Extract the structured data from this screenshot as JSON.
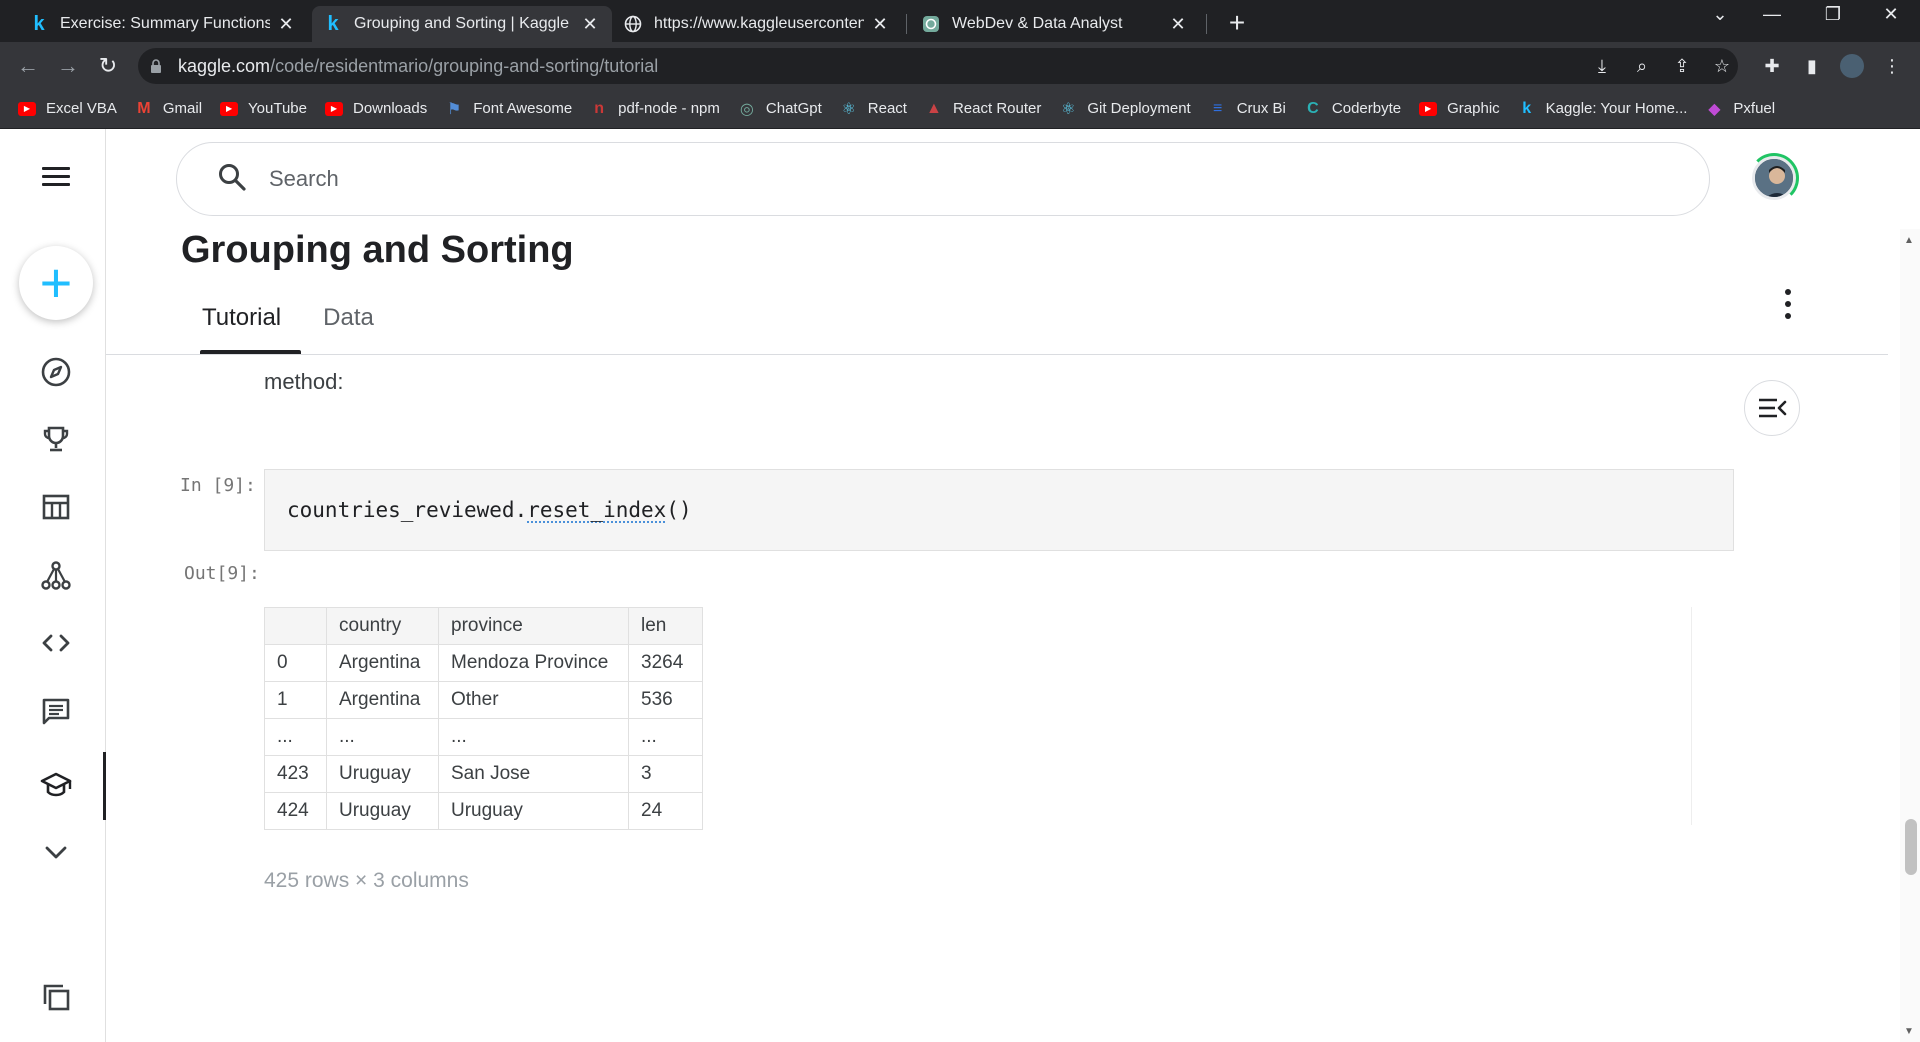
{
  "browser": {
    "tabs": [
      {
        "title": "Exercise: Summary Functions and",
        "favicon": "kaggle-k",
        "active": false
      },
      {
        "title": "Grouping and Sorting | Kaggle",
        "favicon": "kaggle-k",
        "active": true
      },
      {
        "title": "https://www.kaggleusercontent.c",
        "favicon": "globe",
        "active": false
      },
      {
        "title": "WebDev & Data Analyst",
        "favicon": "chatgpt",
        "active": false
      }
    ],
    "url_host": "kaggle.com",
    "url_path": "/code/residentmario/grouping-and-sorting/tutorial",
    "bookmarks": [
      {
        "label": "Excel VBA",
        "icon": "youtube",
        "color": "#ff0000"
      },
      {
        "label": "Gmail",
        "icon": "gmail",
        "color": "#ea4335"
      },
      {
        "label": "YouTube",
        "icon": "youtube",
        "color": "#ff0000"
      },
      {
        "label": "Downloads",
        "icon": "youtube",
        "color": "#ff0000"
      },
      {
        "label": "Font Awesome",
        "icon": "flag",
        "color": "#538dd7"
      },
      {
        "label": "pdf-node - npm",
        "icon": "npm",
        "color": "#cb3837"
      },
      {
        "label": "ChatGpt",
        "icon": "chatgpt",
        "color": "#74aa9c"
      },
      {
        "label": "React",
        "icon": "react",
        "color": "#61dafb"
      },
      {
        "label": "React Router",
        "icon": "react-router",
        "color": "#ca4245"
      },
      {
        "label": "Git Deployment",
        "icon": "react",
        "color": "#61dafb"
      },
      {
        "label": "Crux Bi",
        "icon": "crux",
        "color": "#2f6fde"
      },
      {
        "label": "Coderbyte",
        "icon": "coderbyte",
        "color": "#2bb1b5"
      },
      {
        "label": "Graphic",
        "icon": "youtube",
        "color": "#ff0000"
      },
      {
        "label": "Kaggle: Your Home...",
        "icon": "kaggle-k",
        "color": "#20beff"
      },
      {
        "label": "Pxfuel",
        "icon": "pxfuel",
        "color": "#c04bd6"
      }
    ]
  },
  "search": {
    "placeholder": "Search"
  },
  "notebook": {
    "title": "Grouping and Sorting",
    "tabs": [
      "Tutorial",
      "Data"
    ],
    "active_tab": "Tutorial",
    "prose_tail": "method:",
    "cell_in_prompt": "In [9]:",
    "cell_code_obj": "countries_reviewed.",
    "cell_code_fn": "reset_index",
    "cell_code_args": "()",
    "cell_out_prompt": "Out[9]:",
    "table": {
      "columns": [
        "",
        "country",
        "province",
        "len"
      ],
      "rows": [
        [
          "0",
          "Argentina",
          "Mendoza Province",
          "3264"
        ],
        [
          "1",
          "Argentina",
          "Other",
          "536"
        ],
        [
          "...",
          "...",
          "...",
          "..."
        ],
        [
          "423",
          "Uruguay",
          "San Jose",
          "3"
        ],
        [
          "424",
          "Uruguay",
          "Uruguay",
          "24"
        ]
      ]
    },
    "summary": "425 rows × 3 columns"
  },
  "colors": {
    "kaggle_blue": "#20beff",
    "progress_green": "#20c464"
  }
}
